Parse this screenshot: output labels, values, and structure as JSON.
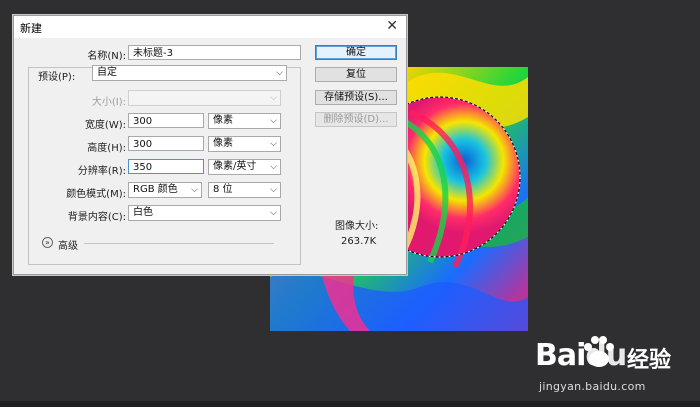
{
  "dialog": {
    "title": "新建",
    "close_glyph": "✕",
    "name_label": "名称(N):",
    "name_value": "未标题-3",
    "preset_label": "预设(P):",
    "preset_value": "自定",
    "size_label": "大小(I):",
    "size_value": "",
    "width_label": "宽度(W):",
    "width_value": "300",
    "width_unit": "像素",
    "height_label": "高度(H):",
    "height_value": "300",
    "height_unit": "像素",
    "resolution_label": "分辨率(R):",
    "resolution_value": "350",
    "resolution_unit": "像素/英寸",
    "color_mode_label": "颜色模式(M):",
    "color_mode_value": "RGB 颜色",
    "bit_depth_value": "8 位",
    "background_label": "背景内容(C):",
    "background_value": "白色",
    "advanced_label": "高级",
    "buttons": {
      "ok": "确定",
      "reset": "复位",
      "save_preset": "存储预设(S)...",
      "delete_preset": "删除预设(D)..."
    },
    "image_size_label": "图像大小:",
    "image_size_value": "263.7K"
  },
  "watermark": {
    "logo_bai": "Bai",
    "logo_du": "du",
    "cn": "经验",
    "url": "jingyan.baidu.com"
  },
  "icons": {
    "dropdown": "chevron-down-icon",
    "advanced": "double-chevron-down-icon"
  }
}
